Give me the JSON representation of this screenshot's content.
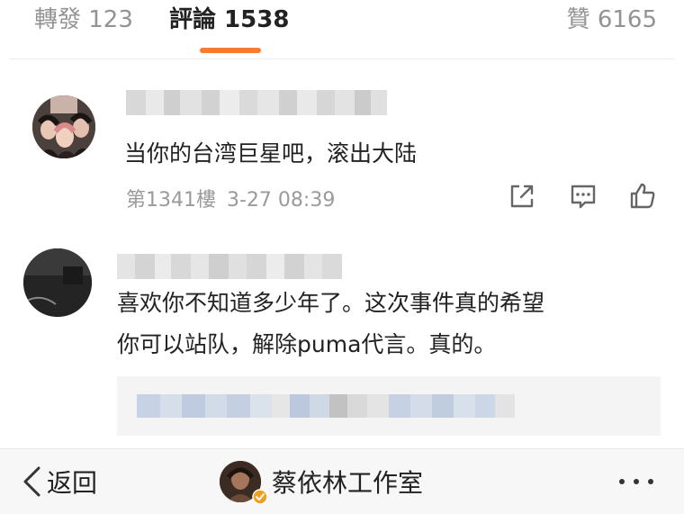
{
  "tabs": [
    {
      "label": "轉發 123"
    },
    {
      "label": "評論 1538"
    },
    {
      "label": "贊 6165"
    }
  ],
  "colors": {
    "accent": "#f47c37",
    "verified": "#f0a020"
  },
  "comments": [
    {
      "text": "当你的台湾巨星吧，滚出大陆",
      "floor": "第1341樓",
      "time": "3-27 08:39",
      "actions": [
        "share-icon",
        "reply-icon",
        "like-icon"
      ]
    },
    {
      "text_line1": "喜欢你不知道多少年了。这次事件真的希望",
      "text_line2": "你可以站队，解除puma代言。真的。"
    }
  ],
  "bottom_bar": {
    "back_label": "返回",
    "account_name": "蔡依林工作室"
  }
}
